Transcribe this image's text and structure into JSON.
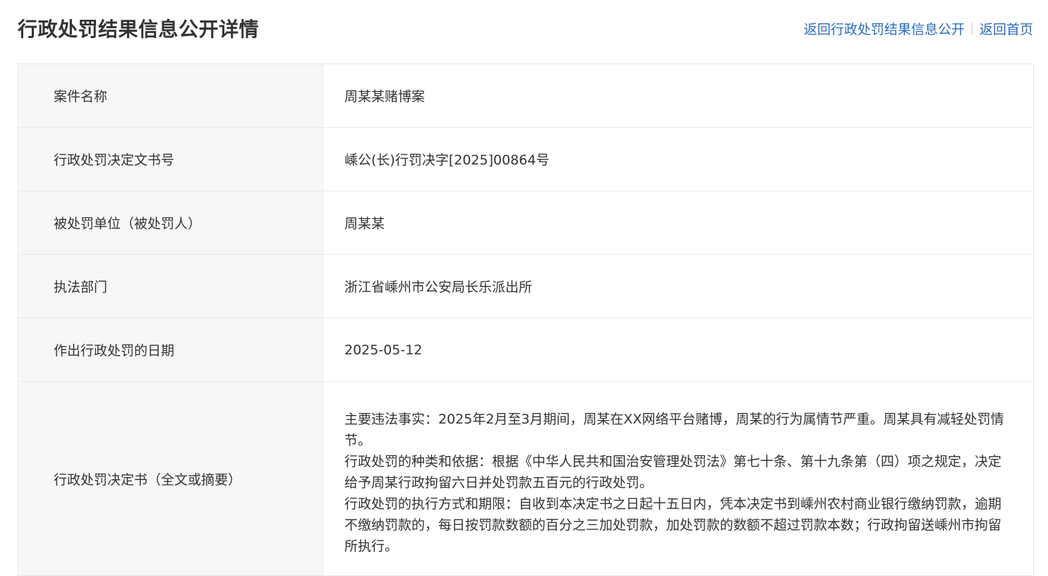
{
  "header": {
    "title": "行政处罚结果信息公开详情",
    "link_back_list": "返回行政处罚结果信息公开",
    "link_home": "返回首页"
  },
  "rows": [
    {
      "label": "案件名称",
      "value": "周某某赌博案"
    },
    {
      "label": "行政处罚决定文书号",
      "value": "嵊公(长)行罚决字[2025]00864号"
    },
    {
      "label": "被处罚单位（被处罚人）",
      "value": "周某某"
    },
    {
      "label": "执法部门",
      "value": "浙江省嵊州市公安局长乐派出所"
    },
    {
      "label": "作出行政处罚的日期",
      "value": "2025-05-12"
    }
  ],
  "decision": {
    "label": "行政处罚决定书（全文或摘要）",
    "paragraphs": [
      "主要违法事实：2025年2月至3月期间，周某在XX网络平台赌博，周某的行为属情节严重。周某具有减轻处罚情节。",
      "行政处罚的种类和依据：根据《中华人民共和国治安管理处罚法》第七十条、第十九条第（四）项之规定，决定给予周某行政拘留六日并处罚款五百元的行政处罚。",
      "行政处罚的执行方式和期限：自收到本决定书之日起十五日内，凭本决定书到嵊州农村商业银行缴纳罚款，逾期不缴纳罚款的，每日按罚款数额的百分之三加处罚款，加处罚款的数额不超过罚款本数；行政拘留送嵊州市拘留所执行。"
    ]
  }
}
